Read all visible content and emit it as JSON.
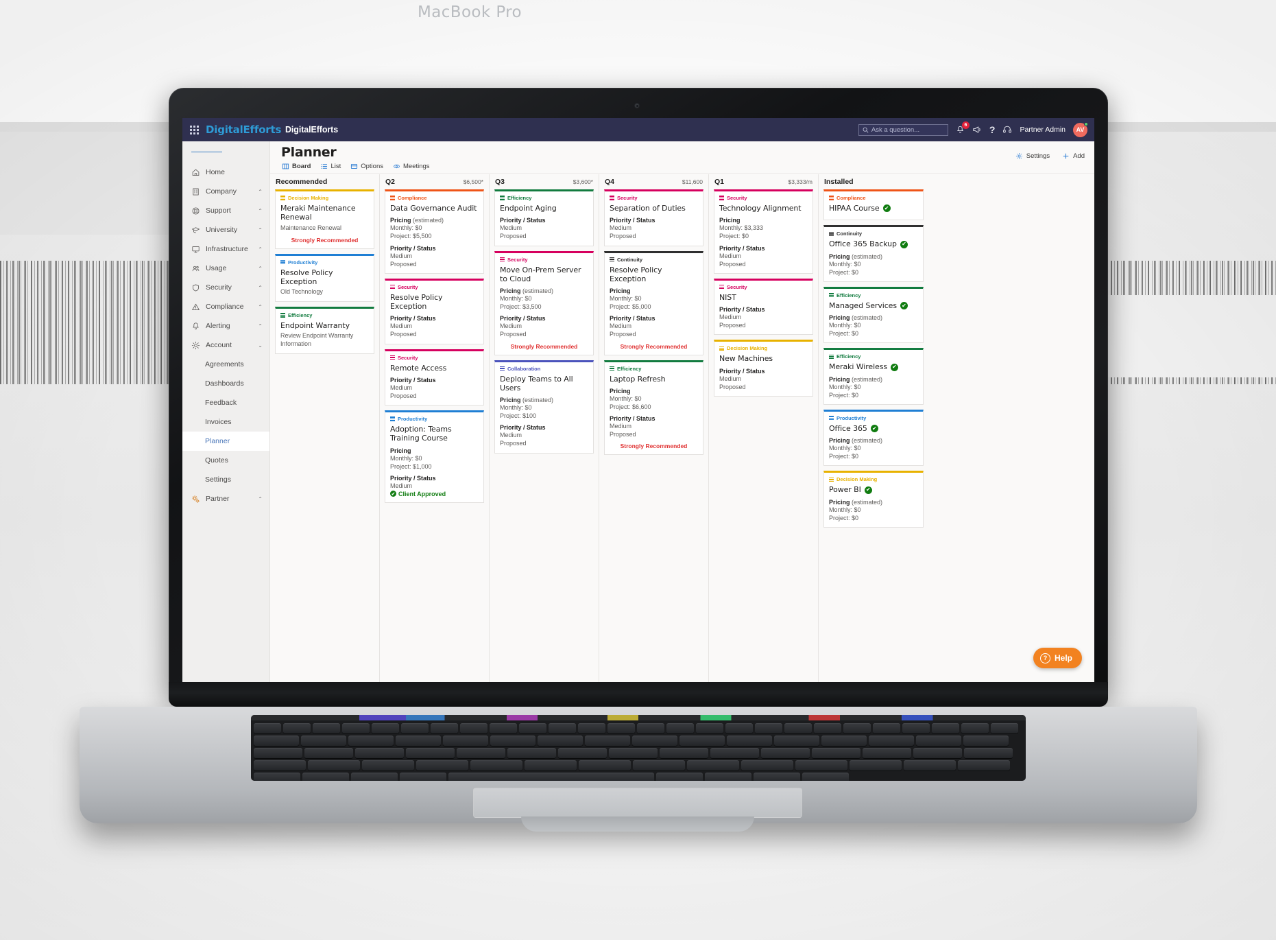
{
  "device": {
    "label": "MacBook Pro"
  },
  "appbar": {
    "waffle_icon": "waffle-grid-icon",
    "brand": "DigitalEfforts",
    "app_name": "DigitalEfforts",
    "search_placeholder": "Ask a question...",
    "search_icon": "search-icon",
    "bell_icon": "bell-icon",
    "bell_badge": "6",
    "megaphone_icon": "megaphone-icon",
    "help_icon": "question-mark-icon",
    "headset_icon": "headset-icon",
    "user_name": "Partner Admin",
    "avatar_initials": "AV"
  },
  "sidebar": {
    "menu_icon": "hamburger-icon",
    "items": [
      {
        "label": "Home",
        "icon": "home-icon",
        "chevron": ""
      },
      {
        "label": "Company",
        "icon": "building-icon",
        "chevron": "^"
      },
      {
        "label": "Support",
        "icon": "lifebuoy-icon",
        "chevron": "^"
      },
      {
        "label": "University",
        "icon": "graduation-icon",
        "chevron": "^"
      },
      {
        "label": "Infrastructure",
        "icon": "monitor-icon",
        "chevron": "^"
      },
      {
        "label": "Usage",
        "icon": "people-icon",
        "chevron": "^"
      },
      {
        "label": "Security",
        "icon": "shield-icon",
        "chevron": "^"
      },
      {
        "label": "Compliance",
        "icon": "warning-icon",
        "chevron": "^"
      },
      {
        "label": "Alerting",
        "icon": "bell-icon",
        "chevron": "^"
      },
      {
        "label": "Account",
        "icon": "gear-icon",
        "chevron": "v"
      }
    ],
    "sub_items": [
      {
        "label": "Agreements",
        "active": false
      },
      {
        "label": "Dashboards",
        "active": false
      },
      {
        "label": "Feedback",
        "active": false
      },
      {
        "label": "Invoices",
        "active": false
      },
      {
        "label": "Planner",
        "active": true
      },
      {
        "label": "Quotes",
        "active": false
      },
      {
        "label": "Settings",
        "active": false
      }
    ],
    "partner": {
      "label": "Partner",
      "icon": "gears-icon",
      "chevron": "^"
    }
  },
  "page": {
    "title": "Planner",
    "tabs": [
      {
        "label": "Board",
        "icon": "board-icon",
        "active": true
      },
      {
        "label": "List",
        "icon": "list-icon",
        "active": false
      },
      {
        "label": "Options",
        "icon": "options-icon",
        "active": false
      },
      {
        "label": "Meetings",
        "icon": "meetings-icon",
        "active": false
      }
    ],
    "actions": [
      {
        "label": "Settings",
        "icon": "gear-icon"
      },
      {
        "label": "Add",
        "icon": "plus-icon"
      }
    ]
  },
  "help": {
    "label": "Help",
    "icon": "question-circle-icon"
  },
  "category_colors": {
    "Decision Making": "#e8b200",
    "Productivity": "#1f7fd4",
    "Efficiency": "#127b3f",
    "Compliance": "#ef5418",
    "Security": "#d6005e",
    "Continuity": "#2f2f2f",
    "Collaboration": "#4b53bc"
  },
  "board": {
    "columns": [
      {
        "title": "Recommended",
        "amount": "",
        "cards": [
          {
            "category": "Decision Making",
            "title": "Meraki Maintenance Renewal",
            "subtitle": "Maintenance Renewal",
            "pricing_label": "",
            "pricing_note": "",
            "monthly": "",
            "project": "",
            "ps_label": "",
            "priority": "",
            "status": "",
            "recommended": "Strongly Recommended",
            "approved": "",
            "installed": false
          },
          {
            "category": "Productivity",
            "title": "Resolve Policy Exception",
            "subtitle": "Old Technology",
            "pricing_label": "",
            "pricing_note": "",
            "monthly": "",
            "project": "",
            "ps_label": "",
            "priority": "",
            "status": "",
            "recommended": "",
            "approved": "",
            "installed": false
          },
          {
            "category": "Efficiency",
            "title": "Endpoint Warranty",
            "subtitle": "Review Endpoint Warranty Information",
            "pricing_label": "",
            "pricing_note": "",
            "monthly": "",
            "project": "",
            "ps_label": "",
            "priority": "",
            "status": "",
            "recommended": "",
            "approved": "",
            "installed": false
          }
        ]
      },
      {
        "title": "Q2",
        "amount": "$6,500*",
        "cards": [
          {
            "category": "Compliance",
            "title": "Data Governance Audit",
            "subtitle": "",
            "pricing_label": "Pricing",
            "pricing_note": "(estimated)",
            "monthly": "Monthly: $0",
            "project": "Project: $5,500",
            "ps_label": "Priority / Status",
            "priority": "Medium",
            "status": "Proposed",
            "recommended": "",
            "approved": "",
            "installed": false
          },
          {
            "category": "Security",
            "title": "Resolve Policy Exception",
            "subtitle": "",
            "pricing_label": "",
            "pricing_note": "",
            "monthly": "",
            "project": "",
            "ps_label": "Priority / Status",
            "priority": "Medium",
            "status": "Proposed",
            "recommended": "",
            "approved": "",
            "installed": false
          },
          {
            "category": "Security",
            "title": "Remote Access",
            "subtitle": "",
            "pricing_label": "",
            "pricing_note": "",
            "monthly": "",
            "project": "",
            "ps_label": "Priority / Status",
            "priority": "Medium",
            "status": "Proposed",
            "recommended": "",
            "approved": "",
            "installed": false
          },
          {
            "category": "Productivity",
            "title": "Adoption: Teams Training Course",
            "subtitle": "",
            "pricing_label": "Pricing",
            "pricing_note": "",
            "monthly": "Monthly: $0",
            "project": "Project: $1,000",
            "ps_label": "Priority / Status",
            "priority": "Medium",
            "status": "",
            "recommended": "",
            "approved": "Client Approved",
            "installed": false
          }
        ]
      },
      {
        "title": "Q3",
        "amount": "$3,600*",
        "cards": [
          {
            "category": "Efficiency",
            "title": "Endpoint Aging",
            "subtitle": "",
            "pricing_label": "",
            "pricing_note": "",
            "monthly": "",
            "project": "",
            "ps_label": "Priority / Status",
            "priority": "Medium",
            "status": "Proposed",
            "recommended": "",
            "approved": "",
            "installed": false
          },
          {
            "category": "Security",
            "title": "Move On-Prem Server to Cloud",
            "subtitle": "",
            "pricing_label": "Pricing",
            "pricing_note": "(estimated)",
            "monthly": "Monthly: $0",
            "project": "Project: $3,500",
            "ps_label": "Priority / Status",
            "priority": "Medium",
            "status": "Proposed",
            "recommended": "Strongly Recommended",
            "approved": "",
            "installed": false
          },
          {
            "category": "Collaboration",
            "title": "Deploy Teams to All Users",
            "subtitle": "",
            "pricing_label": "Pricing",
            "pricing_note": "(estimated)",
            "monthly": "Monthly: $0",
            "project": "Project: $100",
            "ps_label": "Priority / Status",
            "priority": "Medium",
            "status": "Proposed",
            "recommended": "",
            "approved": "",
            "installed": false
          }
        ]
      },
      {
        "title": "Q4",
        "amount": "$11,600",
        "cards": [
          {
            "category": "Security",
            "title": "Separation of Duties",
            "subtitle": "",
            "pricing_label": "",
            "pricing_note": "",
            "monthly": "",
            "project": "",
            "ps_label": "Priority / Status",
            "priority": "Medium",
            "status": "Proposed",
            "recommended": "",
            "approved": "",
            "installed": false
          },
          {
            "category": "Continuity",
            "title": "Resolve Policy Exception",
            "subtitle": "",
            "pricing_label": "Pricing",
            "pricing_note": "",
            "monthly": "Monthly: $0",
            "project": "Project: $5,000",
            "ps_label": "Priority / Status",
            "priority": "Medium",
            "status": "Proposed",
            "recommended": "Strongly Recommended",
            "approved": "",
            "installed": false
          },
          {
            "category": "Efficiency",
            "title": "Laptop Refresh",
            "subtitle": "",
            "pricing_label": "Pricing",
            "pricing_note": "",
            "monthly": "Monthly: $0",
            "project": "Project: $6,600",
            "ps_label": "Priority / Status",
            "priority": "Medium",
            "status": "Proposed",
            "recommended": "Strongly Recommended",
            "approved": "",
            "installed": false
          }
        ]
      },
      {
        "title": "Q1",
        "amount": "$3,333/m",
        "cards": [
          {
            "category": "Security",
            "title": "Technology Alignment",
            "subtitle": "",
            "pricing_label": "Pricing",
            "pricing_note": "",
            "monthly": "Monthly: $3,333",
            "project": "Project: $0",
            "ps_label": "Priority / Status",
            "priority": "Medium",
            "status": "Proposed",
            "recommended": "",
            "approved": "",
            "installed": false
          },
          {
            "category": "Security",
            "title": "NIST",
            "subtitle": "",
            "pricing_label": "",
            "pricing_note": "",
            "monthly": "",
            "project": "",
            "ps_label": "Priority / Status",
            "priority": "Medium",
            "status": "Proposed",
            "recommended": "",
            "approved": "",
            "installed": false
          },
          {
            "category": "Decision Making",
            "title": "New Machines",
            "subtitle": "",
            "pricing_label": "",
            "pricing_note": "",
            "monthly": "",
            "project": "",
            "ps_label": "Priority / Status",
            "priority": "Medium",
            "status": "Proposed",
            "recommended": "",
            "approved": "",
            "installed": false
          }
        ]
      },
      {
        "title": "Installed",
        "amount": "",
        "cards": [
          {
            "category": "Compliance",
            "title": "HIPAA Course",
            "subtitle": "",
            "pricing_label": "",
            "pricing_note": "",
            "monthly": "",
            "project": "",
            "ps_label": "",
            "priority": "",
            "status": "",
            "recommended": "",
            "approved": "",
            "installed": true
          },
          {
            "category": "Continuity",
            "title": "Office 365 Backup",
            "subtitle": "",
            "pricing_label": "Pricing",
            "pricing_note": "(estimated)",
            "monthly": "Monthly: $0",
            "project": "Project: $0",
            "ps_label": "",
            "priority": "",
            "status": "",
            "recommended": "",
            "approved": "",
            "installed": true
          },
          {
            "category": "Efficiency",
            "title": "Managed Services",
            "subtitle": "",
            "pricing_label": "Pricing",
            "pricing_note": "(estimated)",
            "monthly": "Monthly: $0",
            "project": "Project: $0",
            "ps_label": "",
            "priority": "",
            "status": "",
            "recommended": "",
            "approved": "",
            "installed": true
          },
          {
            "category": "Efficiency",
            "title": "Meraki Wireless",
            "subtitle": "",
            "pricing_label": "Pricing",
            "pricing_note": "(estimated)",
            "monthly": "Monthly: $0",
            "project": "Project: $0",
            "ps_label": "",
            "priority": "",
            "status": "",
            "recommended": "",
            "approved": "",
            "installed": true
          },
          {
            "category": "Productivity",
            "title": "Office 365",
            "subtitle": "",
            "pricing_label": "Pricing",
            "pricing_note": "(estimated)",
            "monthly": "Monthly: $0",
            "project": "Project: $0",
            "ps_label": "",
            "priority": "",
            "status": "",
            "recommended": "",
            "approved": "",
            "installed": true
          },
          {
            "category": "Decision Making",
            "title": "Power BI",
            "subtitle": "",
            "pricing_label": "Pricing",
            "pricing_note": "(estimated)",
            "monthly": "Monthly: $0",
            "project": "Project: $0",
            "ps_label": "",
            "priority": "",
            "status": "",
            "recommended": "",
            "approved": "",
            "installed": true
          }
        ]
      }
    ]
  }
}
